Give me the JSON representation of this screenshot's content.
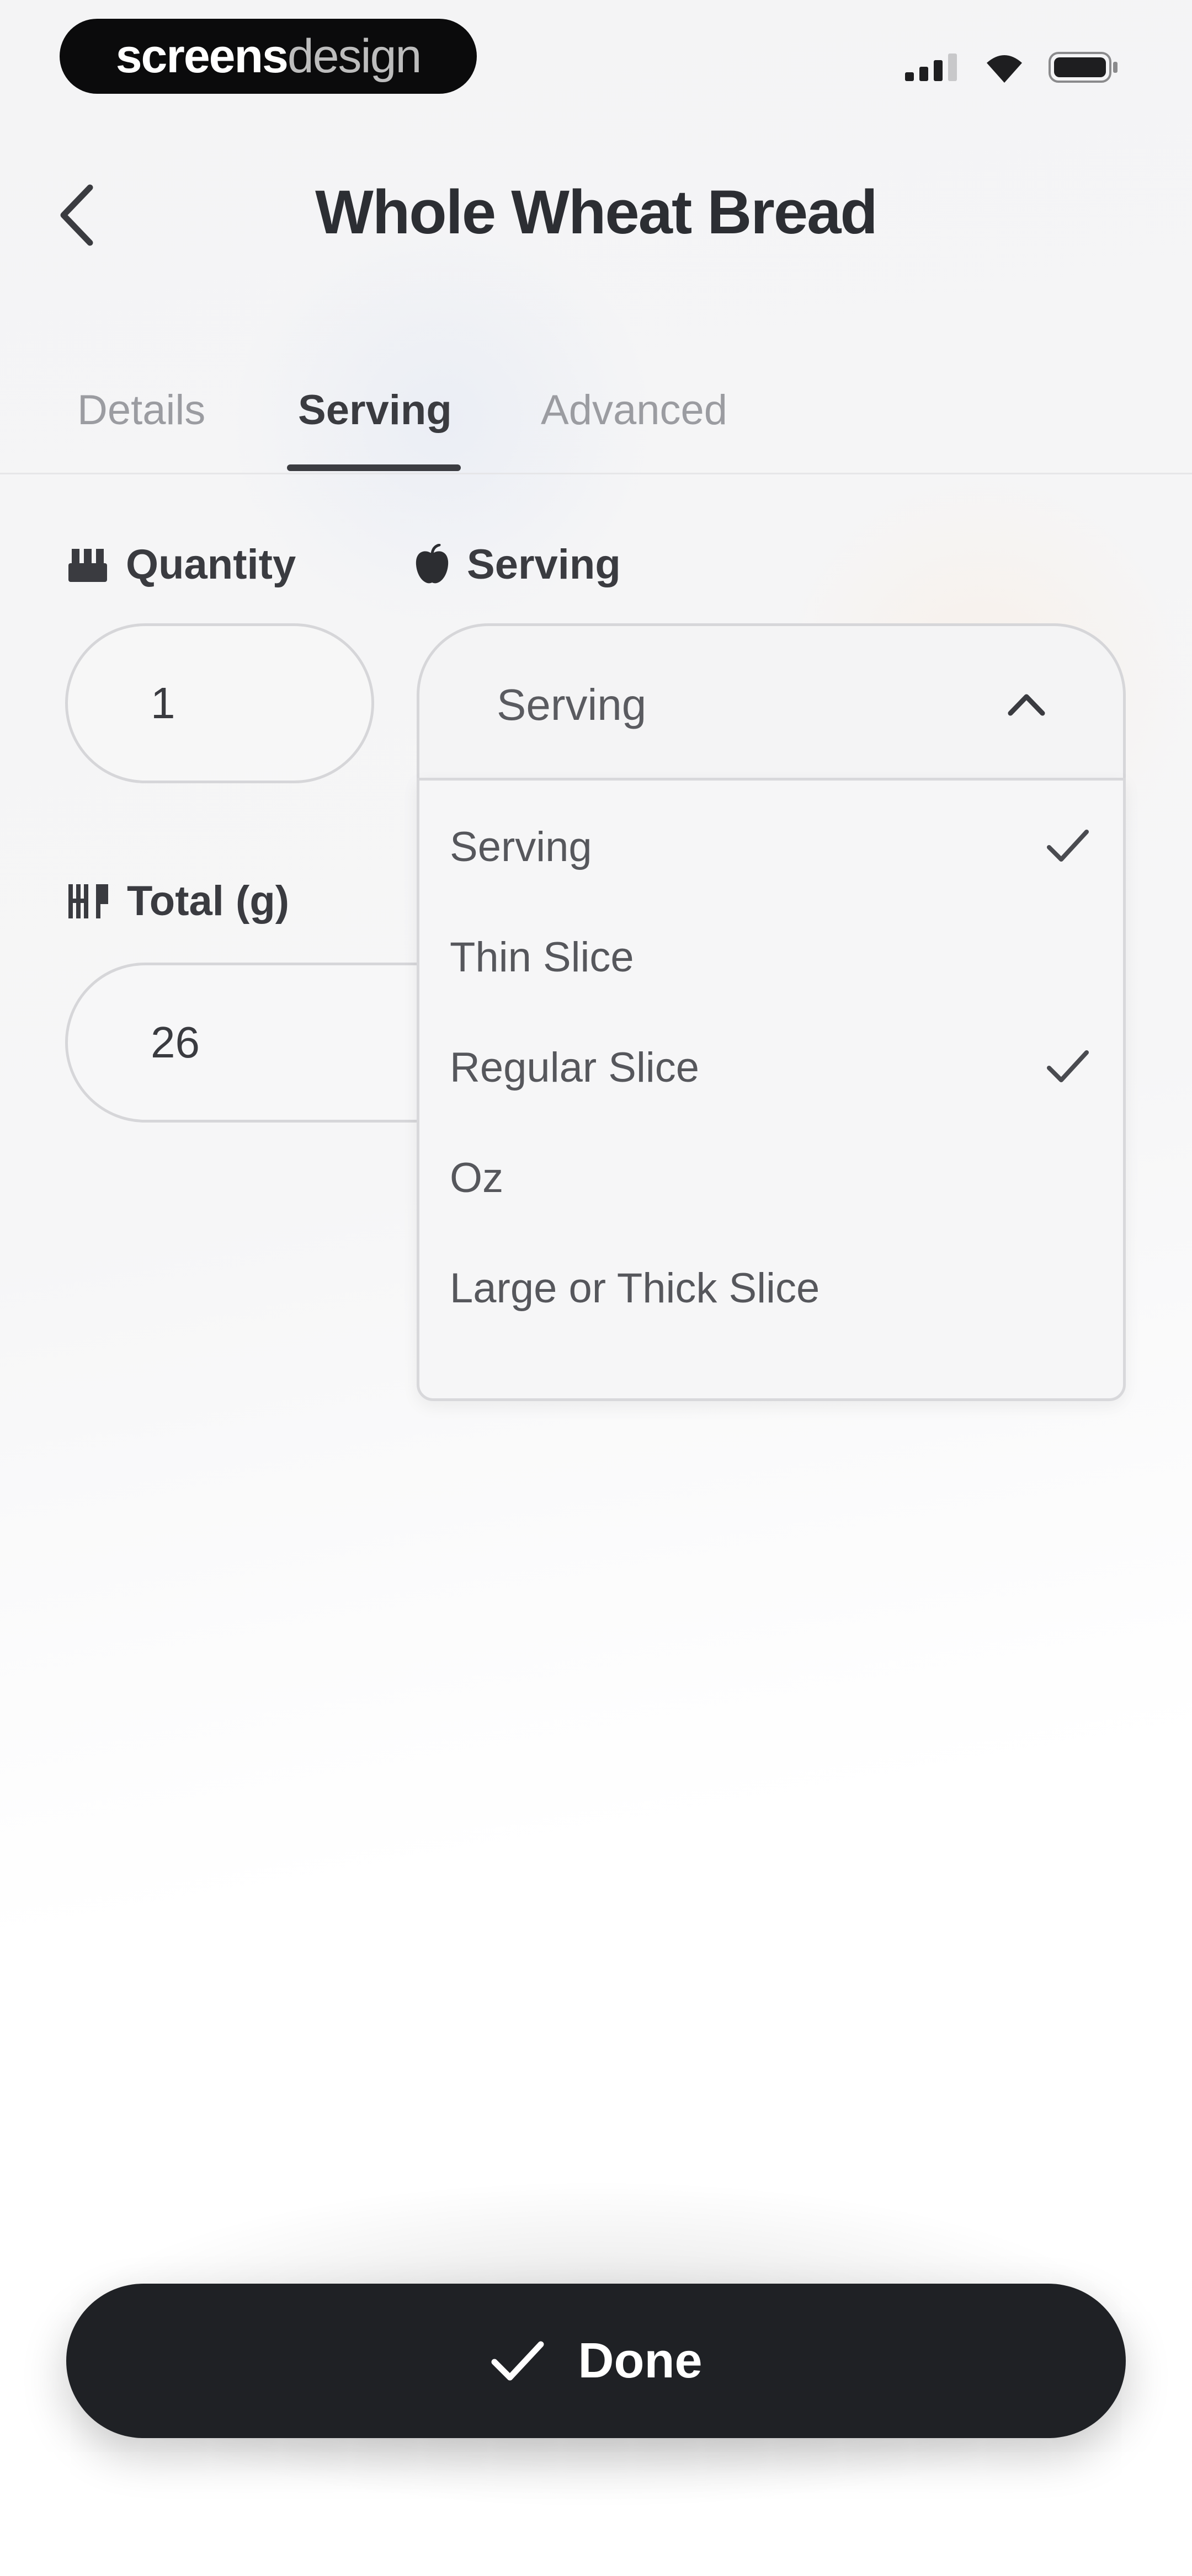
{
  "status_bar": {
    "brand_part1": "screens",
    "brand_part2": "design"
  },
  "header": {
    "title": "Whole Wheat Bread"
  },
  "tabs": [
    {
      "label": "Details",
      "active": false
    },
    {
      "label": "Serving",
      "active": true
    },
    {
      "label": "Advanced",
      "active": false
    }
  ],
  "quantity": {
    "label": "Quantity",
    "value": "1",
    "icon": "scale-icon"
  },
  "serving": {
    "label": "Serving",
    "selected": "Serving",
    "icon": "apple-icon",
    "options": [
      {
        "label": "Serving",
        "checked": true
      },
      {
        "label": "Thin Slice",
        "checked": false
      },
      {
        "label": "Regular Slice",
        "checked": true
      },
      {
        "label": "Oz",
        "checked": false
      },
      {
        "label": "Large or Thick Slice",
        "checked": false
      }
    ]
  },
  "total": {
    "label": "Total (g)",
    "value": "26",
    "icon": "utensils-icon"
  },
  "done_button": {
    "label": "Done",
    "icon": "check-icon"
  },
  "colors": {
    "primary_dark": "#1f2125",
    "text": "#2c2e33",
    "muted": "#9b9ca1",
    "border": "#d6d6d9"
  }
}
